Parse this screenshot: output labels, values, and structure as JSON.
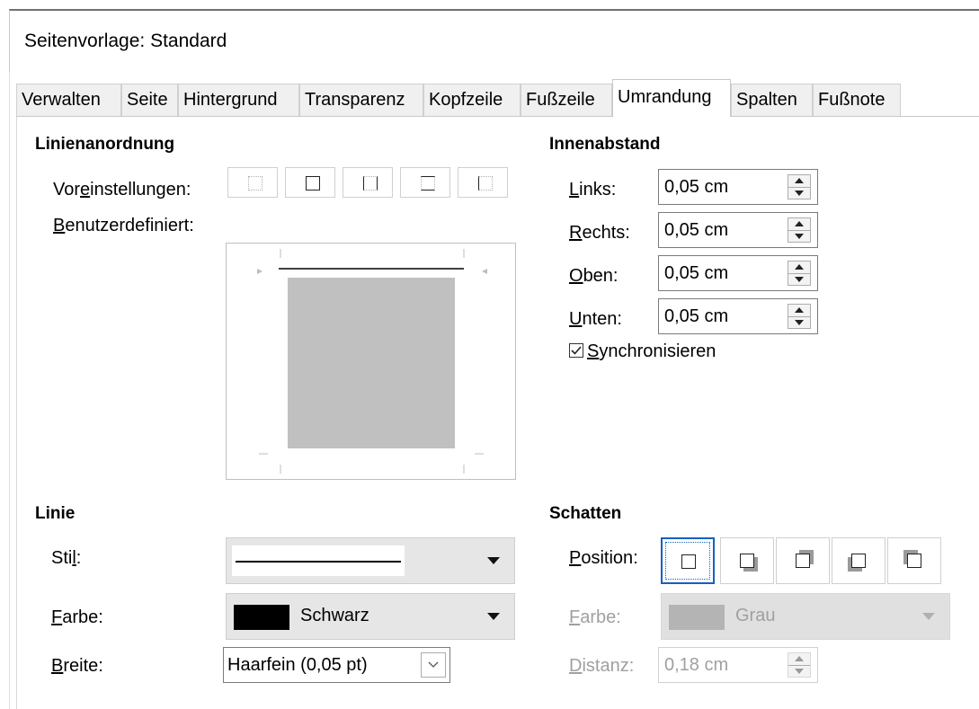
{
  "window": {
    "title": "Seitenvorlage: Standard"
  },
  "tabs": [
    {
      "label": "Verwalten"
    },
    {
      "label": "Seite"
    },
    {
      "label": "Hintergrund"
    },
    {
      "label": "Transparenz"
    },
    {
      "label": "Kopfzeile"
    },
    {
      "label": "Fußzeile"
    },
    {
      "label": "Umrandung",
      "active": true
    },
    {
      "label": "Spalten"
    },
    {
      "label": "Fußnote"
    }
  ],
  "line_arrangement": {
    "heading": "Linienanordnung",
    "presets_label_pre": "Vor",
    "presets_label_ul": "e",
    "presets_label_post": "instellungen:",
    "custom_label_ul": "B",
    "custom_label_post": "enutzerdefiniert:",
    "presets": [
      "no-borders-icon",
      "outer-border-icon",
      "left-right-borders-icon",
      "top-bottom-borders-icon",
      "left-border-icon"
    ]
  },
  "padding": {
    "heading": "Innenabstand",
    "fields": [
      {
        "ul": "L",
        "rest": "inks:",
        "value": "0,05 cm"
      },
      {
        "ul": "R",
        "rest": "echts:",
        "value": "0,05 cm"
      },
      {
        "ul": "O",
        "rest": "ben:",
        "value": "0,05 cm"
      },
      {
        "ul": "U",
        "rest": "nten:",
        "value": "0,05 cm"
      }
    ],
    "sync_ul": "S",
    "sync_rest": "ynchronisieren",
    "sync_checked": true
  },
  "line": {
    "heading": "Linie",
    "style_label_pre": "Sti",
    "style_label_ul": "l",
    "style_label_post": ":",
    "color_label_ul": "F",
    "color_label_post": "arbe:",
    "color_value": "Schwarz",
    "color_swatch": "#000000",
    "width_label_ul": "B",
    "width_label_post": "reite:",
    "width_value": "Haarfein (0,05 pt)"
  },
  "shadow": {
    "heading": "Schatten",
    "position_label_ul": "P",
    "position_label_post": "osition:",
    "positions": [
      "no-shadow-icon",
      "shadow-bottom-right-icon",
      "shadow-top-right-icon",
      "shadow-bottom-left-icon",
      "shadow-top-left-icon"
    ],
    "selected_position": 0,
    "color_label_ul": "F",
    "color_label_post": "arbe:",
    "color_value": "Grau",
    "color_swatch": "#b4b4b4",
    "distance_label_ul": "D",
    "distance_label_post": "istanz:",
    "distance_value": "0,18 cm"
  }
}
